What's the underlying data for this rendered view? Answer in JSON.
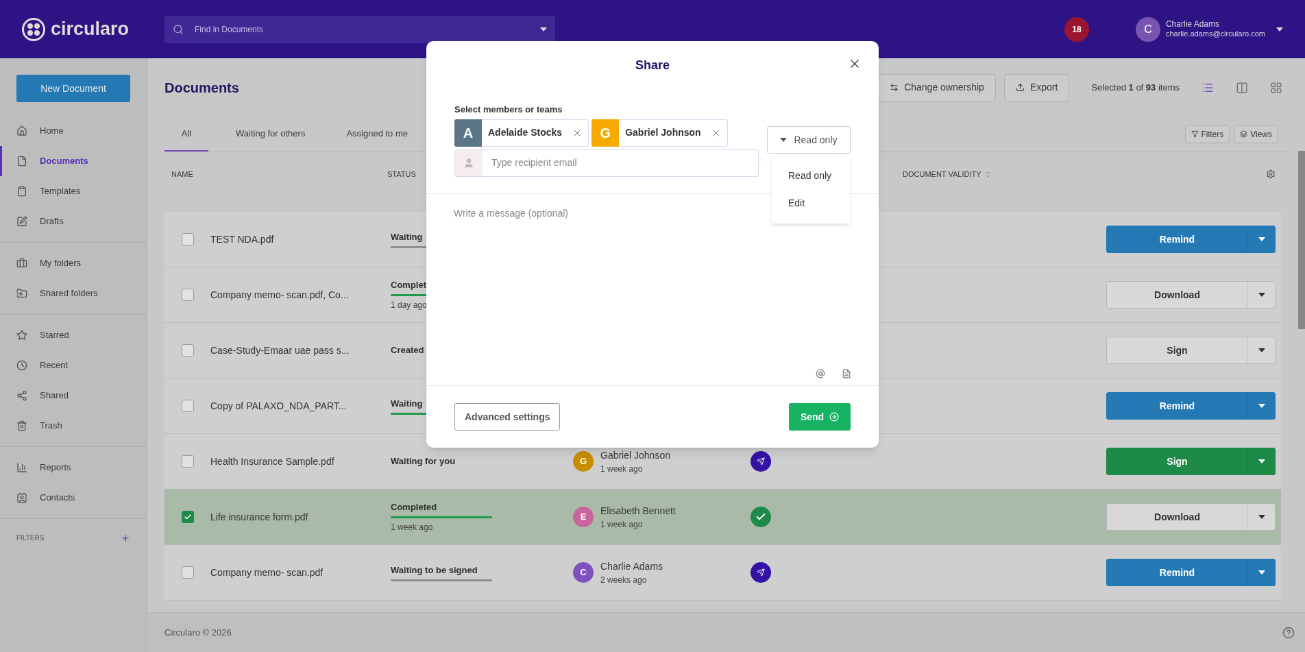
{
  "header": {
    "logo": "circularo",
    "search": {
      "placeholder": "Find in Documents"
    },
    "notifications": "18",
    "user": {
      "initial": "C",
      "name": "Charlie Adams",
      "email": "charlie.adams@circularo.com"
    }
  },
  "sidebar": {
    "new_button": "New Document",
    "groups": [
      [
        {
          "label": "Home",
          "selected": false
        },
        {
          "label": "Documents",
          "selected": true
        },
        {
          "label": "Templates",
          "selected": false
        },
        {
          "label": "Drafts",
          "selected": false
        }
      ],
      [
        {
          "label": "My folders",
          "selected": false
        },
        {
          "label": "Shared folders",
          "selected": false
        }
      ],
      [
        {
          "label": "Starred",
          "selected": false
        },
        {
          "label": "Recent",
          "selected": false
        },
        {
          "label": "Shared",
          "selected": false
        },
        {
          "label": "Trash",
          "selected": false
        }
      ],
      [
        {
          "label": "Reports",
          "selected": false
        },
        {
          "label": "Contacts",
          "selected": false
        }
      ]
    ],
    "filters_label": "FILTERS"
  },
  "main": {
    "title": "Documents",
    "actions": [
      "Change ownership",
      "Export"
    ],
    "selection": "Selected **1** of **93** items",
    "tabs": [
      {
        "label": "All",
        "selected": true
      },
      {
        "label": "Waiting for others",
        "selected": false
      },
      {
        "label": "Assigned to me",
        "selected": false
      }
    ],
    "tools": [
      "Filters",
      "Views"
    ],
    "columns": [
      "NAME",
      "STATUS",
      "DOCUMENT VALIDITY"
    ],
    "rows": [
      {
        "name": "TEST NDA.pdf",
        "selected": false,
        "status": "Waiting",
        "progress": {
          "level": 1,
          "color": "#8f8f8f"
        },
        "action": {
          "label": "Remind",
          "kind": "primary"
        }
      },
      {
        "name": "Company memo- scan.pdf, Co...",
        "selected": false,
        "status": "Complet",
        "progress": {
          "level": 1,
          "color": "#1f9a4b"
        },
        "time": "1 day ago",
        "action": {
          "label": "Download",
          "kind": "secondary"
        }
      },
      {
        "name": "Case-Study-Emaar uae pass s...",
        "selected": false,
        "status": "Created",
        "action": {
          "label": "Sign",
          "kind": "secondary"
        }
      },
      {
        "name": "Copy of PALAXO_NDA_PART...",
        "selected": false,
        "status": "Waiting",
        "progress": {
          "level": 1,
          "color": "#1f9a4b"
        },
        "action": {
          "label": "Remind",
          "kind": "primary"
        }
      },
      {
        "name": "Health Insurance Sample.pdf",
        "selected": false,
        "status": "Waiting for you",
        "owner": {
          "initial": "G",
          "name": "Gabriel Johnson",
          "time": "1 week ago",
          "color": "#c98d00"
        },
        "doc_icon": {
          "kind": "pending"
        },
        "action": {
          "label": "Sign",
          "kind": "success"
        }
      },
      {
        "name": "Life insurance form.pdf",
        "selected": true,
        "status": "Completed",
        "progress": {
          "level": 1,
          "color": "#1f9a4b"
        },
        "time": "1 week ago",
        "owner": {
          "initial": "E",
          "name": "Elisabeth Bennett",
          "time": "1 week ago",
          "color": "#c8649e"
        },
        "doc_icon": {
          "kind": "done"
        },
        "action": {
          "label": "Download",
          "kind": "secondary"
        }
      },
      {
        "name": "Company memo- scan.pdf",
        "selected": false,
        "status": "Waiting to be signed",
        "progress": {
          "level": 1,
          "color": "#8f8f8f"
        },
        "owner": {
          "initial": "C",
          "name": "Charlie Adams",
          "time": "2 weeks ago",
          "color": "#7d52bf"
        },
        "doc_icon": {
          "kind": "pending"
        },
        "action": {
          "label": "Remind",
          "kind": "primary"
        }
      }
    ]
  },
  "footer": "Circularo © 2026",
  "modal": {
    "title": "Share",
    "label": "Select members or teams",
    "chips": [
      {
        "initial": "A",
        "name": "Adelaide Stocks",
        "color": "#5b7686"
      },
      {
        "initial": "G",
        "name": "Gabriel Johnson",
        "color": "#f7aa00"
      }
    ],
    "email": {
      "placeholder": "Type recipient email"
    },
    "permission": {
      "label": "Read only",
      "options": [
        "Read only",
        "Edit"
      ]
    },
    "message": {
      "placeholder": "Write a message (optional)"
    },
    "advanced": "Advanced settings",
    "send": "Send"
  }
}
